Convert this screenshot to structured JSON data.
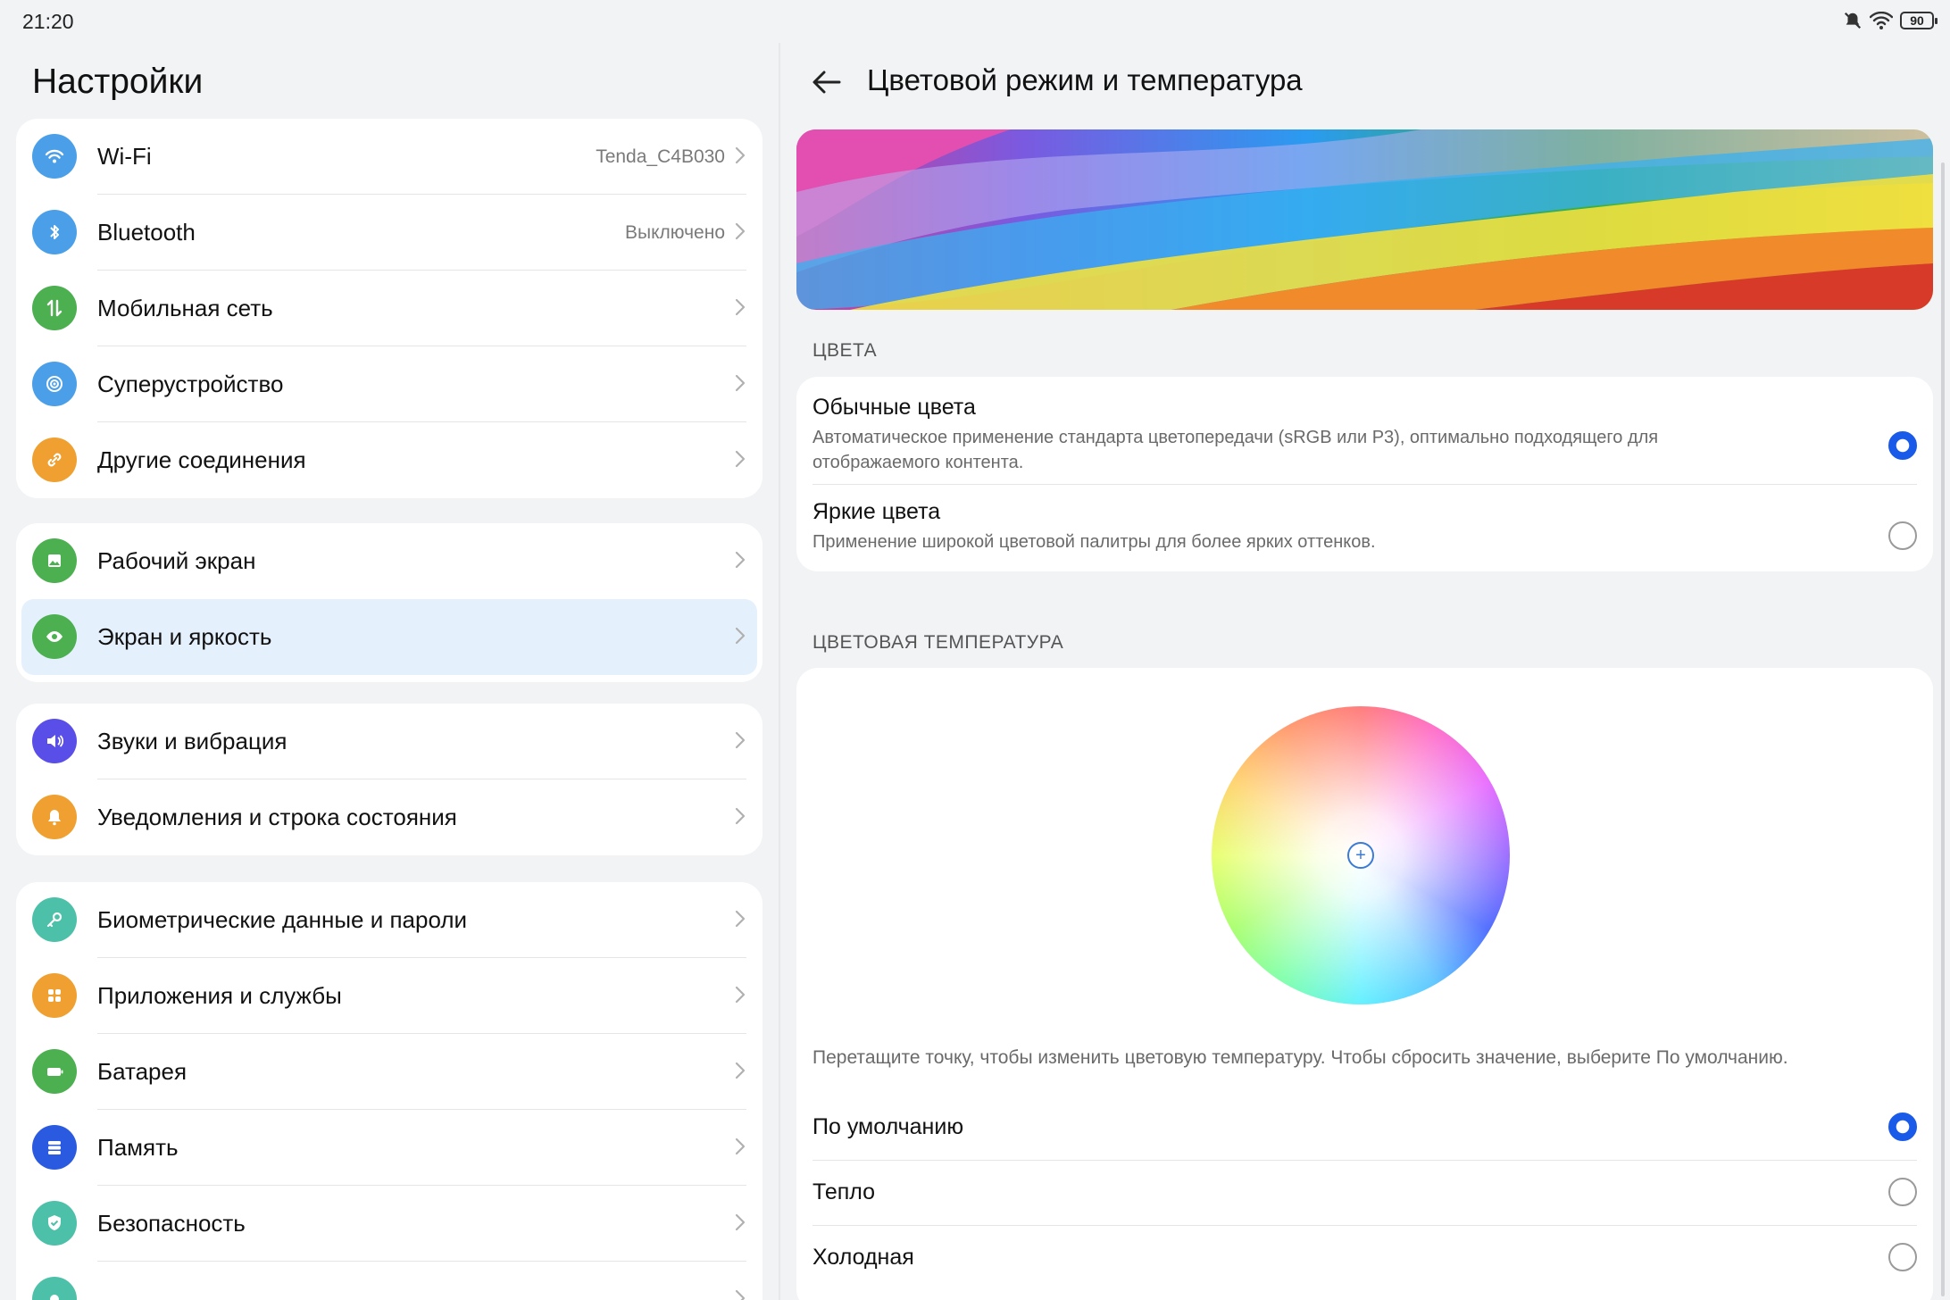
{
  "status": {
    "time": "21:20",
    "battery": "90"
  },
  "left": {
    "title": "Настройки",
    "groups": [
      [
        {
          "label": "Wi-Fi",
          "value": "Tenda_C4B030",
          "icon": "wifi-icon",
          "color": "#4a9fe8"
        },
        {
          "label": "Bluetooth",
          "value": "Выключено",
          "icon": "bluetooth-icon",
          "color": "#4a9fe8"
        },
        {
          "label": "Мобильная сеть",
          "value": "",
          "icon": "mobile-data-icon",
          "color": "#4caf50"
        },
        {
          "label": "Суперустройство",
          "value": "",
          "icon": "super-device-icon",
          "color": "#4a9fe8"
        },
        {
          "label": "Другие соединения",
          "value": "",
          "icon": "link-icon",
          "color": "#f0a030"
        }
      ],
      [
        {
          "label": "Рабочий экран",
          "value": "",
          "icon": "wallpaper-icon",
          "color": "#4caf50"
        },
        {
          "label": "Экран и яркость",
          "value": "",
          "icon": "eye-icon",
          "color": "#4caf50",
          "active": true
        }
      ],
      [
        {
          "label": "Звуки и вибрация",
          "value": "",
          "icon": "sound-icon",
          "color": "#5a4ee8"
        },
        {
          "label": "Уведомления и строка состояния",
          "value": "",
          "icon": "bell-icon",
          "color": "#f0a030"
        }
      ],
      [
        {
          "label": "Биометрические данные и пароли",
          "value": "",
          "icon": "key-icon",
          "color": "#4cc0a8"
        },
        {
          "label": "Приложения и службы",
          "value": "",
          "icon": "apps-icon",
          "color": "#f0a030"
        },
        {
          "label": "Батарея",
          "value": "",
          "icon": "battery-icon",
          "color": "#4caf50"
        },
        {
          "label": "Память",
          "value": "",
          "icon": "storage-icon",
          "color": "#2a5ae0"
        },
        {
          "label": "Безопасность",
          "value": "",
          "icon": "shield-icon",
          "color": "#4cc0a8"
        },
        {
          "label": "",
          "value": "",
          "icon": "partial-icon",
          "color": "#4cc0a8"
        }
      ]
    ]
  },
  "right": {
    "title": "Цветовой режим и температура",
    "colors_section": "ЦВЕТА",
    "color_options": [
      {
        "title": "Обычные цвета",
        "desc": "Автоматическое применение стандарта цветопередачи (sRGB или P3), оптимально подходящего для отображаемого контента.",
        "selected": true
      },
      {
        "title": "Яркие цвета",
        "desc": "Применение широкой цветовой палитры для более ярких оттенков.",
        "selected": false
      }
    ],
    "temp_section": "ЦВЕТОВАЯ ТЕМПЕРАТУРА",
    "hint": "Перетащите точку, чтобы изменить цветовую температуру. Чтобы сбросить значение, выберите По умолчанию.",
    "temp_options": [
      {
        "title": "По умолчанию",
        "selected": true
      },
      {
        "title": "Тепло",
        "selected": false
      },
      {
        "title": "Холодная",
        "selected": false
      }
    ]
  },
  "accent": "#1a5ae8"
}
